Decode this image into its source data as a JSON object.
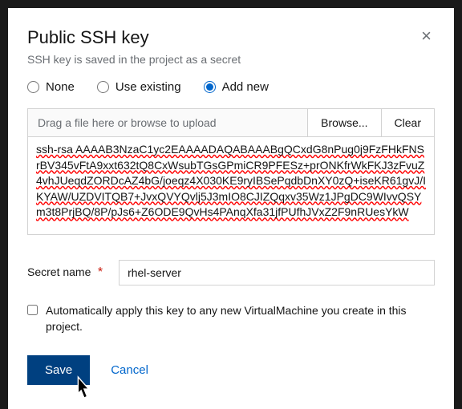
{
  "modal": {
    "title": "Public SSH key",
    "description": "SSH key is saved in the project as a secret",
    "radios": {
      "none": "None",
      "use_existing": "Use existing",
      "add_new": "Add new"
    },
    "upload": {
      "placeholder": "Drag a file here or browse to upload",
      "browse": "Browse...",
      "clear": "Clear"
    },
    "ssh_value": "ssh-rsa AAAAB3NzaC1yc2EAAAADAQABAAABgQCxdG8nPug0j9FzFHkFNSrBV345vFtA9xxt632tQ8CxWsubTGsGPmiCR9PFESz+prONKfrWkFKJ3zFvuZ4vhJUeqdZORDcAZ4bG/joeqz4X030KE9ryIBSePqdbDnXY0zQ+iseKR61gvJ/IKYAW/UZDVITQB7+JvxQVYQvlj5J3mIO8CJIZQqxv35Wz1JPgDC9WIvvQSYm3t8PrjBQ/8P/pJs6+Z6ODE9QvHs4PAnqXfa31jfPUfhJVxZ2F9nRUesYkW",
    "secret_label": "Secret name",
    "secret_value": "rhel-server",
    "auto_apply": "Automatically apply this key to any new VirtualMachine you create in this project.",
    "footer": {
      "save": "Save",
      "cancel": "Cancel"
    }
  }
}
